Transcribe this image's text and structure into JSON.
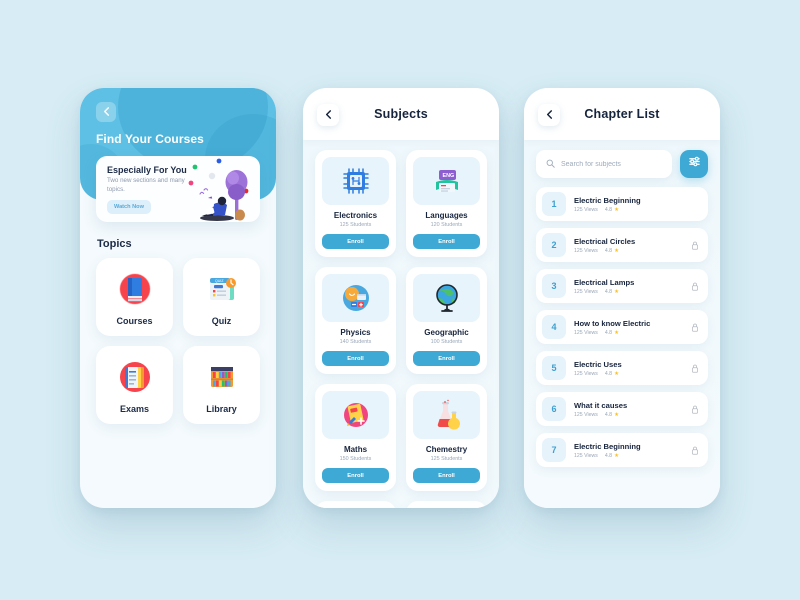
{
  "theme": {
    "page_bg": "#d7ecf4",
    "primary_blue": "#3ea9d4",
    "hero_blue": "#5ec0e4",
    "navy_text": "#17243d",
    "muted_text": "#9aa7b8",
    "star_yellow": "#f7c32e"
  },
  "screen1": {
    "back_icon": "chevron-left-icon",
    "hero_title": "Find Your Courses",
    "promo": {
      "title": "Especially For You",
      "subtitle": "Two new sections and many topics.",
      "cta": "Watch Now",
      "illustration": "person-reading-under-tree"
    },
    "topics_label": "Topics",
    "topics": [
      {
        "label": "Courses",
        "icon": "book-icon"
      },
      {
        "label": "Quiz",
        "icon": "quiz-icon"
      },
      {
        "label": "Exams",
        "icon": "exam-papers-icon"
      },
      {
        "label": "Library",
        "icon": "bookshelf-icon"
      }
    ]
  },
  "screen2": {
    "back_icon": "chevron-left-icon",
    "title": "Subjects",
    "enroll_label": "Enroll",
    "subjects": [
      {
        "name": "Electronics",
        "students": "125 Students",
        "icon": "microchip-icon"
      },
      {
        "name": "Languages",
        "students": "120 Students",
        "icon": "eng-book-icon"
      },
      {
        "name": "Physics",
        "students": "140 Students",
        "icon": "physics-icon"
      },
      {
        "name": "Geographic",
        "students": "100 Students",
        "icon": "globe-icon"
      },
      {
        "name": "Maths",
        "students": "150 Students",
        "icon": "maths-icon"
      },
      {
        "name": "Chemestry",
        "students": "125 Students",
        "icon": "flask-icon"
      }
    ],
    "peek_row": [
      {
        "icon": "physics-icon"
      },
      {
        "icon": "globe-icon"
      }
    ]
  },
  "screen3": {
    "back_icon": "chevron-left-icon",
    "title": "Chapter List",
    "search": {
      "placeholder": "Search for subjects",
      "value": "",
      "icon": "search-icon"
    },
    "filter_icon": "sliders-icon",
    "chapters": [
      {
        "num": "1",
        "title": "Electric Beginning",
        "views": "125 Views",
        "rating": "4.8",
        "locked": false
      },
      {
        "num": "2",
        "title": "Electrical Circles",
        "views": "125 Views",
        "rating": "4.8",
        "locked": true
      },
      {
        "num": "3",
        "title": "Electrical Lamps",
        "views": "125 Views",
        "rating": "4.8",
        "locked": true
      },
      {
        "num": "4",
        "title": "How to know Electric",
        "views": "125 Views",
        "rating": "4.8",
        "locked": true
      },
      {
        "num": "5",
        "title": "Electric Uses",
        "views": "125 Views",
        "rating": "4.8",
        "locked": true
      },
      {
        "num": "6",
        "title": "What it causes",
        "views": "125 Views",
        "rating": "4.8",
        "locked": true
      },
      {
        "num": "7",
        "title": "Electric Beginning",
        "views": "125 Views",
        "rating": "4.8",
        "locked": true
      }
    ],
    "star_glyph": "★"
  }
}
